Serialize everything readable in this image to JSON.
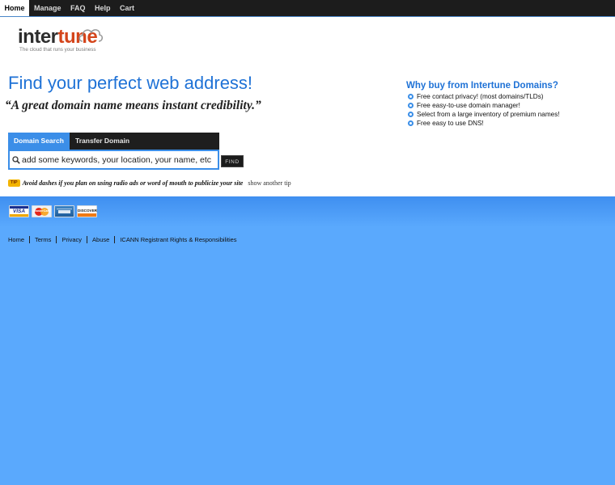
{
  "nav": {
    "items": [
      {
        "label": "Home",
        "active": true
      },
      {
        "label": "Manage",
        "active": false
      },
      {
        "label": "FAQ",
        "active": false
      },
      {
        "label": "Help",
        "active": false
      },
      {
        "label": "Cart",
        "active": false
      }
    ]
  },
  "logo": {
    "word_dark": "inter",
    "word_accent": "tune",
    "tagline": "The cloud that runs your business"
  },
  "hero": {
    "headline": "Find your perfect web address!",
    "quote": "“A great domain name means instant credibility.”"
  },
  "why": {
    "title": "Why buy from Intertune Domains?",
    "items": [
      "Free contact privacy! (most domains/TLDs)",
      "Free easy-to-use domain manager!",
      "Select from a large inventory of premium names!",
      "Free easy to use DNS!"
    ]
  },
  "search": {
    "tabs": [
      "Domain Search",
      "Transfer Domain"
    ],
    "placeholder": "add some keywords, your location, your name, etc",
    "find_label": "FIND"
  },
  "tip": {
    "badge": "TIP",
    "text": "Avoid dashes if you plan on using radio ads or word of mouth to publicize your site",
    "link": "show another tip"
  },
  "cards": {
    "visa": "VISA",
    "mastercard": "MasterCard",
    "discover": "DISCOVER"
  },
  "footer": {
    "links": [
      "Home",
      "Terms",
      "Privacy",
      "Abuse",
      "ICANN Registrant Rights & Responsibilities"
    ]
  },
  "colors": {
    "accent_blue": "#1f72d6",
    "tab_blue": "#3b8ee8",
    "logo_orange": "#d4451b",
    "background_blue": "#5aa9fd"
  }
}
